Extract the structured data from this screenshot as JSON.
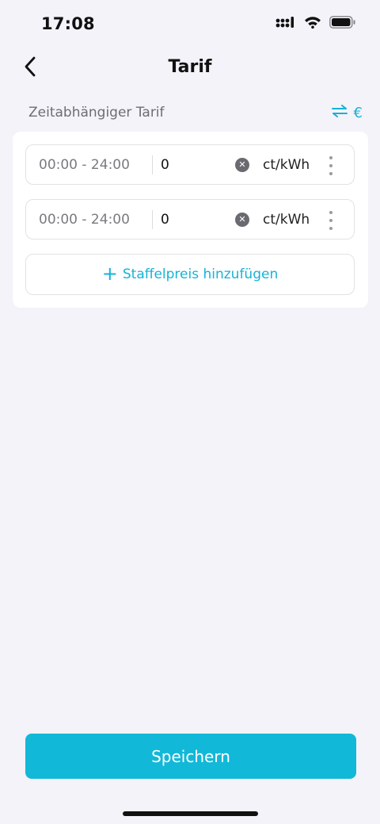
{
  "status_bar": {
    "time": "17:08"
  },
  "header": {
    "title": "Tarif",
    "back_icon": "chevron-left-icon"
  },
  "section": {
    "label": "Zeitabhängiger Tarif",
    "currency_symbol": "€",
    "switch_icon": "swap-arrows-icon"
  },
  "tariffs": [
    {
      "time_range": "00:00 - 24:00",
      "price": "0",
      "unit": "ct/kWh"
    },
    {
      "time_range": "00:00 - 24:00",
      "price": "0",
      "unit": "ct/kWh"
    }
  ],
  "add_tier": {
    "plus": "+",
    "label": "Staffelpreis hinzufügen"
  },
  "save_button": {
    "label": "Speichern"
  },
  "colors": {
    "accent": "#12b8d8",
    "background": "#f4f3f9",
    "card": "#ffffff"
  }
}
